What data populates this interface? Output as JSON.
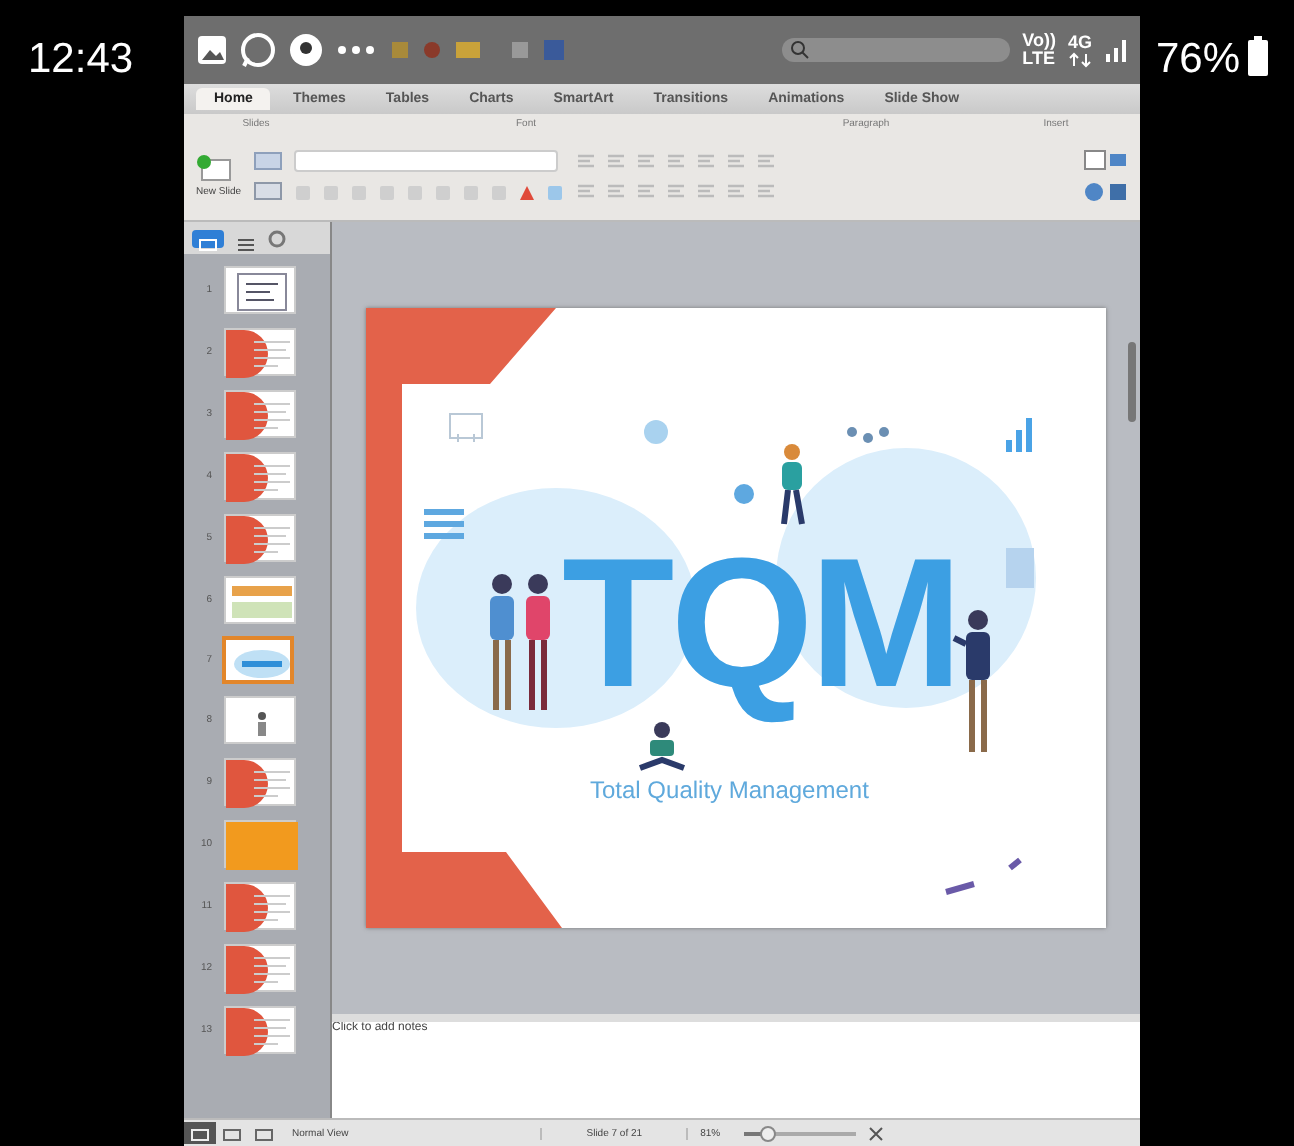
{
  "phone_status": {
    "time": "12:43",
    "volte": "Vo))",
    "lte": "LTE",
    "network": "4G",
    "battery": "76%"
  },
  "tabs": [
    {
      "label": "Home",
      "selected": true
    },
    {
      "label": "Themes",
      "selected": false
    },
    {
      "label": "Tables",
      "selected": false
    },
    {
      "label": "Charts",
      "selected": false
    },
    {
      "label": "SmartArt",
      "selected": false
    },
    {
      "label": "Transitions",
      "selected": false
    },
    {
      "label": "Animations",
      "selected": false
    },
    {
      "label": "Slide Show",
      "selected": false
    }
  ],
  "ribbon": {
    "groups": [
      "Slides",
      "Font",
      "Paragraph",
      "Insert"
    ],
    "new_slide": "New Slide"
  },
  "panel_tabs": [
    {
      "kind": "slides",
      "selected": true
    },
    {
      "kind": "outline",
      "selected": false
    }
  ],
  "thumbnails": [
    {
      "number": "1",
      "kind": "diagram",
      "selected": false
    },
    {
      "number": "2",
      "kind": "red",
      "selected": false
    },
    {
      "number": "3",
      "kind": "red",
      "selected": false
    },
    {
      "number": "4",
      "kind": "red",
      "selected": false
    },
    {
      "number": "5",
      "kind": "red",
      "selected": false
    },
    {
      "number": "6",
      "kind": "banner",
      "selected": false
    },
    {
      "number": "7",
      "kind": "image",
      "selected": true
    },
    {
      "number": "8",
      "kind": "figure",
      "selected": false
    },
    {
      "number": "9",
      "kind": "red",
      "selected": false
    },
    {
      "number": "10",
      "kind": "orange",
      "selected": false
    },
    {
      "number": "11",
      "kind": "red",
      "selected": false
    },
    {
      "number": "12",
      "kind": "red",
      "selected": false
    },
    {
      "number": "13",
      "kind": "red",
      "selected": false
    }
  ],
  "slide": {
    "title": "TQM",
    "subtitle": "Total Quality Management"
  },
  "notes": {
    "placeholder": "Click to add notes"
  },
  "status_bar": {
    "view": "Normal View",
    "slide_info": "Slide 7 of 21",
    "zoom": "81%",
    "zoom_slider": {
      "level": 0.22
    }
  }
}
